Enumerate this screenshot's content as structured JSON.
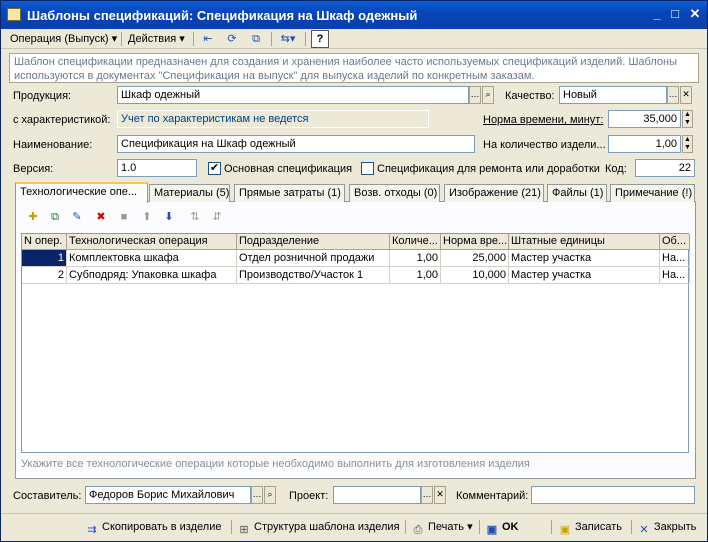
{
  "window": {
    "title": "Шаблоны спецификаций: Спецификация на Шкаф одежный",
    "minimize": "_",
    "maximize": "□",
    "close": "✕"
  },
  "menu": {
    "operation": "Операция (Выпуск)",
    "actions": "Действия",
    "help": "?"
  },
  "info_text": "Шаблон спецификации предназначен для создания и хранения наиболее часто используемых спецификаций изделий. Шаблоны используются в документах \"Спецификация на выпуск\" для выпуска изделий по конкретным заказам.",
  "form": {
    "product_label": "Продукция:",
    "product_value": "Шкаф одежный",
    "quality_label": "Качество:",
    "quality_value": "Новый",
    "characteristic_label": "с характеристикой:",
    "characteristic_value": "Учет по характеристикам не ведется",
    "time_norm_label": "Норма времени, минут:",
    "time_norm_value": "35,000",
    "name_label": "Наименование:",
    "name_value": "Спецификация на Шкаф одежный",
    "quantity_label": "На количество издели...",
    "quantity_value": "1,00",
    "version_label": "Версия:",
    "version_value": "1.0",
    "main_spec_label": "Основная спецификация",
    "main_spec_checked": true,
    "repair_spec_label": "Спецификация для ремонта или доработки",
    "repair_spec_checked": false,
    "code_label": "Код:",
    "code_value": "22"
  },
  "tabs": [
    "Технологические опе...",
    "Материалы (5)",
    "Прямые затраты (1)",
    "Возв. отходы (0)",
    "Изображение (21)",
    "Файлы (1)",
    "Примечание (!)"
  ],
  "grid": {
    "columns": [
      "N опер.",
      "Технологическая операция",
      "Подразделение",
      "Количе...",
      "Норма вре...",
      "Штатные единицы",
      "Об..."
    ],
    "rows": [
      [
        "1",
        "Комплектовка шкафа",
        "Отдел розничной продажи",
        "1,00",
        "25,000",
        "Мастер участка",
        "На..."
      ],
      [
        "2",
        "Субподряд: Упаковка шкафа",
        "Производство/Участок 1",
        "1,00",
        "10,000",
        "Мастер участка",
        "На..."
      ]
    ]
  },
  "hint": "Укажите все технологические операции которые необходимо выполнить для изготовления изделия",
  "footer": {
    "author_label": "Составитель:",
    "author_value": "Федоров Борис Михайлович",
    "project_label": "Проект:",
    "project_value": "",
    "comment_label": "Комментарий:",
    "comment_value": ""
  },
  "buttons": {
    "copy": "Скопировать в изделие",
    "structure": "Структура шаблона изделия",
    "print": "Печать",
    "ok": "OK",
    "save": "Записать",
    "close": "Закрыть"
  },
  "colors": {
    "title_bar": "#0846b8",
    "selection": "#0a246a",
    "link_text": "#004080"
  }
}
